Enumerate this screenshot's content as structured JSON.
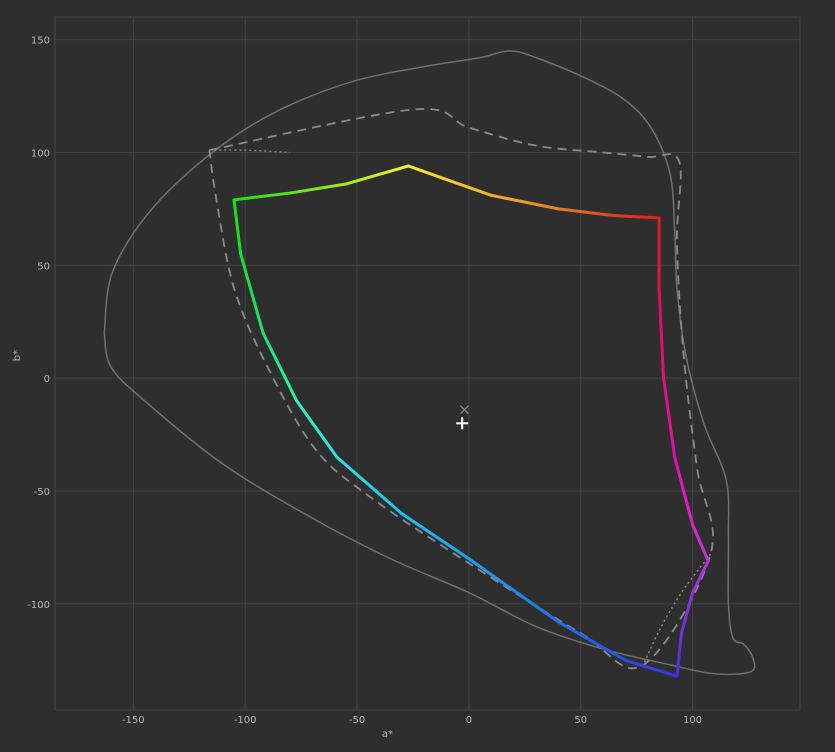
{
  "chart_data": {
    "type": "line",
    "xlabel": "a*",
    "ylabel": "b*",
    "xlim": [
      -185,
      148
    ],
    "ylim": [
      -147,
      160
    ],
    "x_ticks": [
      -150,
      -100,
      -50,
      0,
      50,
      100
    ],
    "y_ticks": [
      150,
      100,
      50,
      0,
      -50,
      -100
    ],
    "x_tick_labels": [
      "-150",
      "-100",
      "-50",
      "0",
      "50",
      "100"
    ],
    "y_tick_labels": [
      "150",
      "100",
      "50",
      "0",
      "-50",
      "-100"
    ],
    "grid": true,
    "legend": "none",
    "colors": {
      "background": "#2e2e2e",
      "grid": "#444444",
      "frame": "#454545",
      "outline": "#707070",
      "dashed": "#8a8a8a",
      "marker": "#ffffff"
    },
    "series": [
      {
        "style": "solid-gray",
        "points": [
          [
            -163,
            20
          ],
          [
            -160,
            45
          ],
          [
            -148,
            67
          ],
          [
            -130,
            87
          ],
          [
            -105,
            107
          ],
          [
            -80,
            121
          ],
          [
            -50,
            132
          ],
          [
            -20,
            138
          ],
          [
            5,
            142
          ],
          [
            18,
            145
          ],
          [
            30,
            142
          ],
          [
            52,
            133
          ],
          [
            70,
            123
          ],
          [
            82,
            110
          ],
          [
            90,
            90
          ],
          [
            92,
            65
          ],
          [
            93,
            40
          ],
          [
            97,
            10
          ],
          [
            105,
            -20
          ],
          [
            115,
            -45
          ],
          [
            116,
            -70
          ],
          [
            116,
            -100
          ],
          [
            118,
            -115
          ],
          [
            123,
            -118
          ],
          [
            127,
            -124
          ],
          [
            126,
            -130
          ],
          [
            110,
            -131
          ],
          [
            90,
            -127
          ],
          [
            60,
            -120
          ],
          [
            30,
            -110
          ],
          [
            0,
            -95
          ],
          [
            -35,
            -80
          ],
          [
            -70,
            -62
          ],
          [
            -110,
            -38
          ],
          [
            -145,
            -10
          ],
          [
            -160,
            5
          ],
          [
            -163,
            20
          ]
        ]
      },
      {
        "style": "dashed-gray",
        "points": [
          [
            -116,
            101
          ],
          [
            -25,
            119
          ],
          [
            0,
            111
          ],
          [
            30,
            103
          ],
          [
            60,
            100
          ],
          [
            80,
            98
          ],
          [
            94,
            96
          ],
          [
            93,
            60
          ],
          [
            96,
            10
          ],
          [
            102,
            -40
          ],
          [
            108,
            -78
          ],
          [
            78,
            -127
          ],
          [
            50,
            -113
          ],
          [
            0,
            -82
          ],
          [
            -45,
            -52
          ],
          [
            -69,
            -31
          ],
          [
            -90,
            5
          ],
          [
            -105,
            40
          ],
          [
            -113,
            80
          ],
          [
            -116,
            101
          ]
        ]
      },
      {
        "style": "dotted-gray",
        "points": [
          [
            -116,
            101
          ],
          [
            -100,
            101
          ],
          [
            -80,
            100
          ]
        ]
      },
      {
        "style": "dotted-gray",
        "points": [
          [
            108,
            -78
          ],
          [
            95,
            -95
          ],
          [
            85,
            -112
          ],
          [
            78,
            -127
          ]
        ]
      },
      {
        "style": "rainbow",
        "points": [
          [
            -105,
            79
          ],
          [
            -80,
            82
          ],
          [
            -55,
            86
          ],
          [
            -27,
            94
          ],
          [
            -10,
            88
          ],
          [
            10,
            81
          ],
          [
            40,
            75
          ],
          [
            65,
            72
          ],
          [
            85,
            71
          ],
          [
            85,
            40
          ],
          [
            87,
            0
          ],
          [
            92,
            -35
          ],
          [
            100,
            -65
          ],
          [
            107,
            -81
          ],
          [
            100,
            -95
          ],
          [
            95,
            -113
          ],
          [
            93,
            -132
          ],
          [
            70,
            -125
          ],
          [
            40,
            -108
          ],
          [
            0,
            -80
          ],
          [
            -30,
            -60
          ],
          [
            -59,
            -35
          ],
          [
            -77,
            -10
          ],
          [
            -92,
            20
          ],
          [
            -102,
            55
          ],
          [
            -105,
            79
          ]
        ],
        "point_colors": [
          "#18e018",
          "#60e020",
          "#a8e828",
          "#f0f030",
          "#f0d030",
          "#f0b030",
          "#e08028",
          "#e04020",
          "#e02020",
          "#e01050",
          "#e01080",
          "#e010b0",
          "#e020d0",
          "#c030e0",
          "#9030e0",
          "#7030e0",
          "#4030e8",
          "#2050e8",
          "#2070e8",
          "#20a0f0",
          "#20c0f0",
          "#30e0e0",
          "#30f0b0",
          "#20e070",
          "#18e030",
          "#18e018"
        ]
      }
    ],
    "markers": [
      {
        "symbol": "x",
        "x": -2,
        "y": -14,
        "color": "#8a8a8a"
      },
      {
        "symbol": "+",
        "x": -3,
        "y": -20,
        "color": "#ffffff"
      }
    ]
  }
}
